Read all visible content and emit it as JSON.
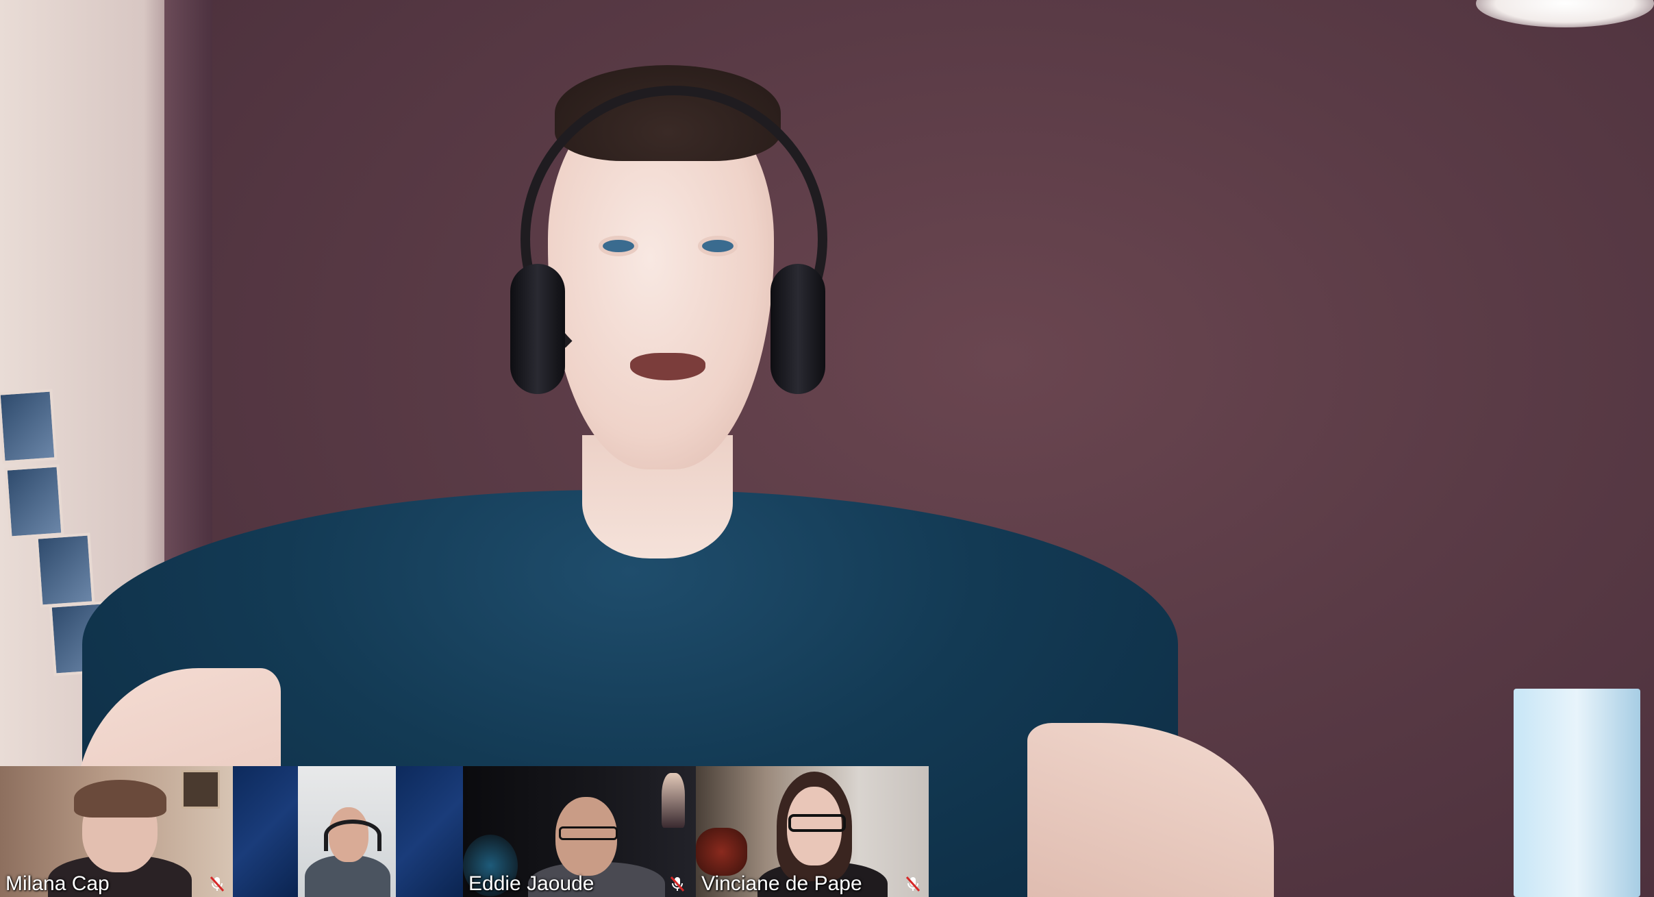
{
  "main_speaker": {
    "label": ""
  },
  "participants": [
    {
      "name": "Milana Cap",
      "muted": true
    },
    {
      "name": "",
      "muted": false
    },
    {
      "name": "Eddie Jaoude",
      "muted": true
    },
    {
      "name": "Vinciane de Pape",
      "muted": true
    }
  ],
  "icons": {
    "muted": "mic-muted-icon"
  },
  "colors": {
    "strip_gap": "#1a3c7a",
    "muted_icon": "#d62828",
    "name_text": "#ffffff"
  }
}
